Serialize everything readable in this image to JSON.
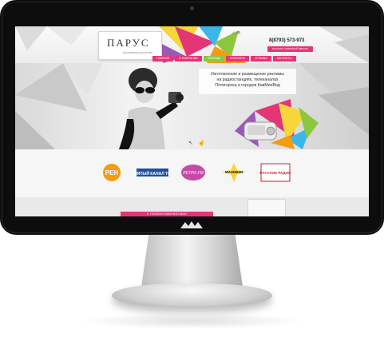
{
  "header": {
    "logo_title": "ПАРУС",
    "logo_subtitle": "РЕКЛАМНОЕ АГЕНТСТВО",
    "top_icons": "♫ ✉",
    "phone": "8(8793) 573-973",
    "callback_button": "ЗАКАЗАТЬ ОБРАТНЫЙ ЗВОНОК"
  },
  "nav": {
    "items": [
      {
        "label": "ГЛАВНАЯ"
      },
      {
        "label": "О КОМПАНИИ"
      },
      {
        "label": "ПОМОЩЬ"
      },
      {
        "label": "КОНТАКТЫ"
      },
      {
        "label": "ОТЗЫВЫ"
      },
      {
        "label": "КОНТАКТЫ"
      }
    ]
  },
  "hero": {
    "text_line1": "Изготовление и размещение рекламы",
    "text_line2": "на радиостанциях, телеканалах",
    "text_line3": "Пятигорска и  городов КавМинВод"
  },
  "stations": [
    {
      "label": "РЕН"
    },
    {
      "label": "ПЯТЫЙ КАНАЛ ТВ"
    },
    {
      "label": "РЕТРО FM"
    },
    {
      "label": "MAXIMUM"
    },
    {
      "label": "РУССКОЕ РАДИО"
    }
  ],
  "why_bar": {
    "label": "ПОЧЕМУ ИМЕННО МЫ?"
  },
  "colors": {
    "accent_pink": "#e43576",
    "accent_green": "#8dc63f",
    "bezel": "#0d0d0d"
  }
}
